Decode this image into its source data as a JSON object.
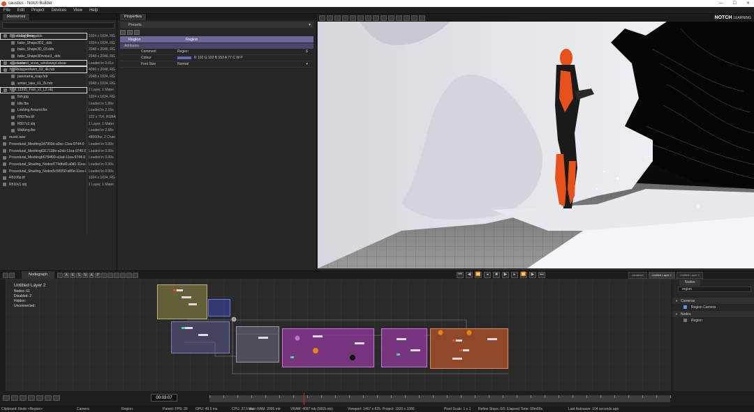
{
  "window": {
    "title": "caustics - Notch Builder",
    "controls": [
      "—",
      "☐",
      "✕"
    ]
  },
  "menu": [
    "File",
    "Edit",
    "Project",
    "Devices",
    "View",
    "Help"
  ],
  "resources": {
    "tab": "Resources",
    "rows": [
      {
        "type": "group",
        "name": "Baked Lightmaps",
        "info": ""
      },
      {
        "type": "item",
        "name": "bake_floor_.dds",
        "info": "1024 x 1024, RG"
      },
      {
        "type": "item",
        "name": "bake_Shape3D2_.dds",
        "info": "1024 x 1024, RG"
      },
      {
        "type": "item",
        "name": "bake_Shape3D_03.dds",
        "info": "2048 x 2048, RG"
      },
      {
        "type": "item",
        "name": "bake_Shape3Dnoise3_.dds",
        "info": "2048 x 2048, RG"
      },
      {
        "type": "group",
        "name": "substance",
        "info": ""
      },
      {
        "type": "item",
        "name": "iceland_snow_windswept.sbsar",
        "info": "Loaded in 0.01s"
      },
      {
        "type": "group",
        "name": "HDR",
        "info": ""
      },
      {
        "type": "item",
        "name": "kloppenheim_02_4k.hdr",
        "info": "4096 x 2048, RG"
      },
      {
        "type": "item",
        "name": "panorama_map.hdr",
        "info": "2048 x 1024, RG"
      },
      {
        "type": "item",
        "name": "winter_lake_01_2k.hdr",
        "info": "2048 x 1024, RG"
      },
      {
        "type": "group",
        "name": "FBX",
        "info": ""
      },
      {
        "type": "item",
        "name": "12265_Fish_v1_L2.obj",
        "info": "1 Layer, 1 Mater"
      },
      {
        "type": "item",
        "name": "fish.jpg",
        "info": "1024 x 1024, RG"
      },
      {
        "type": "item",
        "name": "Idle.fbx",
        "info": "Loaded in 1.89s"
      },
      {
        "type": "item",
        "name": "Looking Around.fbx",
        "info": "Loaded in 2.15s"
      },
      {
        "type": "item",
        "name": "R507tex.tif",
        "info": "122 x 714, RGBA"
      },
      {
        "type": "item",
        "name": "R507v2.obj",
        "info": "1 Layer, 1 Mater"
      },
      {
        "type": "item",
        "name": "Walking.fbx",
        "info": "Loaded in 2.68s"
      },
      {
        "type": "item2",
        "name": "music.wav",
        "info": "48000hz, 2 Chan"
      },
      {
        "type": "item2",
        "name": "Procedural_Meshing1d7993d-a0ac-11ea-9744-0",
        "info": "Loaded in 0.00s"
      },
      {
        "type": "item2",
        "name": "Procedural_Meshing6317138e-a2eb-11ea-9740-0",
        "info": "Loaded in 0.00s"
      },
      {
        "type": "item2",
        "name": "Procedural_Meshingb5784f00-a3ad-11ea-9744-0",
        "info": "Loaded in 0.00s"
      },
      {
        "type": "item2",
        "name": "Procedural_Shading_Nodesf774dbd0-a0d1-11ea-9",
        "info": "Loaded in 0.00s"
      },
      {
        "type": "item2",
        "name": "Procedural_Shading_Nodes5c55550-a85e-11ea-9",
        "info": "Loaded in 0.00s"
      },
      {
        "type": "item2",
        "name": "R5106p.tif",
        "info": "1024 x 1024, RG"
      },
      {
        "type": "item2",
        "name": "R510v1.obj",
        "info": "1 Layer, 1 Mater"
      }
    ]
  },
  "properties": {
    "tab": "Properties",
    "presets": "Presets",
    "node_name": "Region",
    "node_type": "Region",
    "attributes_label": "Attributes",
    "rows": [
      {
        "label": "Comment",
        "value": "Region",
        "extra": "S"
      },
      {
        "label": "Colour",
        "value": "R 102 G 102 B 153 A 77   C   W   P",
        "extra": ""
      },
      {
        "label": "Font Size",
        "value": "Normal",
        "extra": "▾"
      }
    ]
  },
  "logo": {
    "brand": "NOTCH",
    "sub": "LEARNING"
  },
  "nodegraph": {
    "tab": "Nodegraph",
    "tool_letters": [
      "A",
      "K",
      "S",
      "N",
      "A",
      "P"
    ],
    "layer_title": "Untitled Layer 2",
    "stats": [
      "Nodes: 61",
      "Disabled: 2",
      "Hidden:",
      "Unconnected:"
    ]
  },
  "layer_tabs": [
    "caustics2",
    "Untitled Layer 2",
    "Untitled Layer 3"
  ],
  "nodes_panel": {
    "tab": "Nodes",
    "search": "region",
    "rows": [
      {
        "kind": "cat",
        "label": "Cameras"
      },
      {
        "kind": "item",
        "label": "Region Camera",
        "color": "#6b8ee8"
      },
      {
        "kind": "cat",
        "label": "Nodes"
      },
      {
        "kind": "item",
        "label": "Region",
        "color": "#777777"
      }
    ]
  },
  "timeline": {
    "timecode": "00:03:07",
    "playhead_time": "00:03:07"
  },
  "status": [
    {
      "text": "Clipboard: Node <Region>"
    },
    {
      "text": "Camera"
    },
    {
      "text": "Region"
    },
    {
      "text": "Parent: FPS: 30"
    },
    {
      "text": "GPU: 49.5 ms"
    },
    {
      "text": "CPU: 37.5 ms"
    },
    {
      "text": "Main RAM: 2096 mb"
    },
    {
      "text": "VRAM: 4097 mb (5665 mb)"
    },
    {
      "text": "Viewport: 1467 x 825, Project: 1920 x 1080"
    },
    {
      "text": "Pixel Scale: 1 x 1"
    },
    {
      "text": "Refine Steps: 0/0. Elapsed Time: 00m00s"
    },
    {
      "text": "Last Autosave: 104 seconds ago"
    }
  ],
  "colors": {
    "region_purple": "#6b6899",
    "accent_orange": "#e8501a",
    "panel_bg": "#262626"
  }
}
